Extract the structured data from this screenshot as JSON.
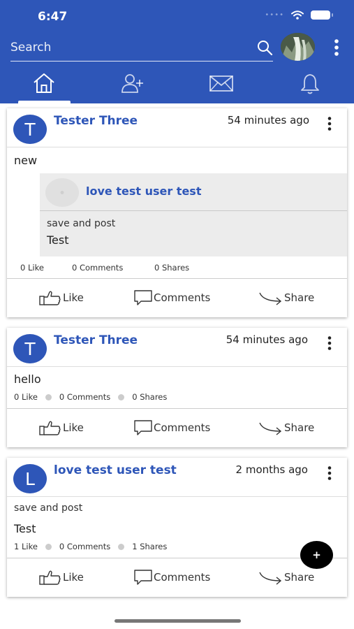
{
  "status_bar": {
    "time": "6:47"
  },
  "search": {
    "placeholder": "Search"
  },
  "tabs": [
    {
      "name": "home",
      "icon": "home-icon"
    },
    {
      "name": "friends",
      "icon": "add-friend-icon"
    },
    {
      "name": "messages",
      "icon": "mail-icon"
    },
    {
      "name": "notifications",
      "icon": "bell-icon"
    }
  ],
  "colors": {
    "brand": "#2e56b8",
    "card_bg": "#ffffff",
    "shared_bg": "#ececec"
  },
  "posts": [
    {
      "avatar_letter": "T",
      "author": "Tester Three",
      "time": "54 minutes ago",
      "text": "new",
      "shared": {
        "author": "love test user test",
        "caption": "save and post",
        "text": "Test"
      },
      "likes": "0 Like",
      "comments": "0 Comments",
      "shares": "0 Shares"
    },
    {
      "avatar_letter": "T",
      "author": "Tester Three",
      "time": "54 minutes ago",
      "text": "hello",
      "likes": "0 Like",
      "comments": "0 Comments",
      "shares": "0 Shares"
    },
    {
      "avatar_letter": "L",
      "author": "love test user test",
      "time": "2 months ago",
      "caption": "save and post",
      "text": "Test",
      "likes": "1 Like",
      "comments": "0 Comments",
      "shares": "1 Shares"
    }
  ],
  "actions": {
    "like": "Like",
    "comments": "Comments",
    "share": "Share"
  },
  "fab": {
    "label": "+"
  }
}
